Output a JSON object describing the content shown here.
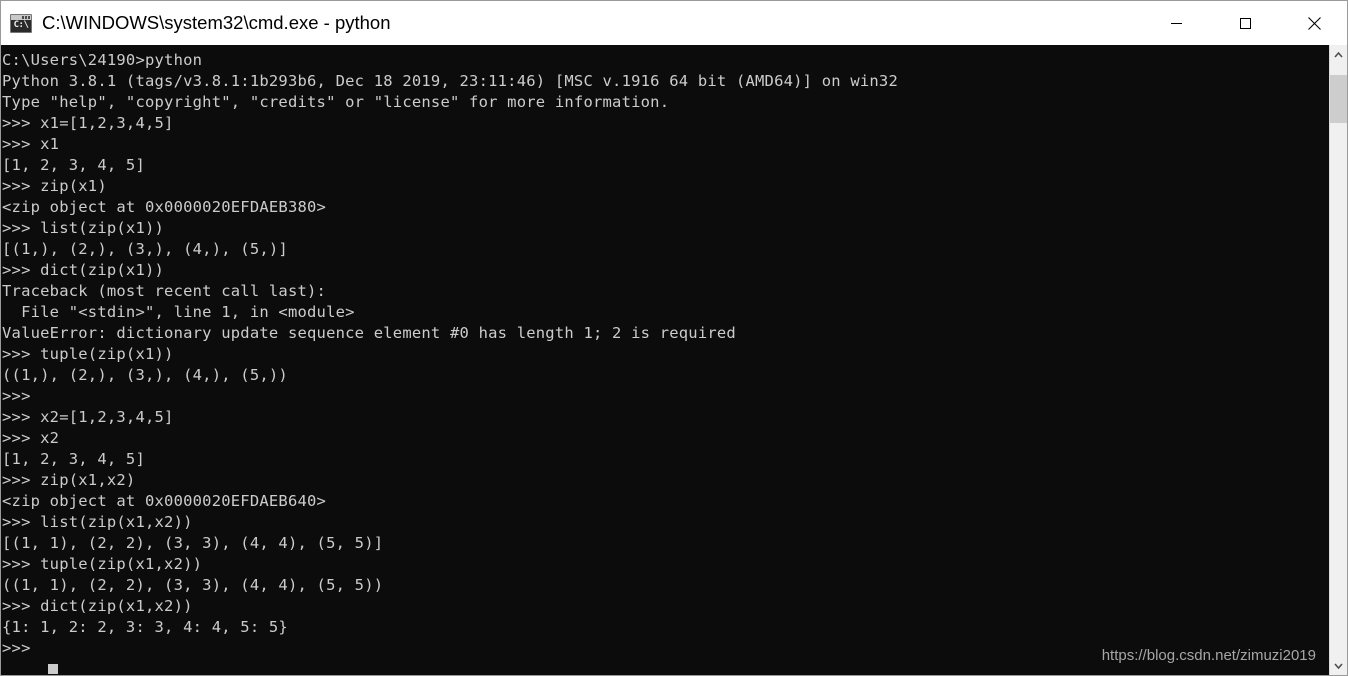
{
  "window": {
    "title": "C:\\WINDOWS\\system32\\cmd.exe - python",
    "icon": "cmd-icon",
    "icon_glyph": "C:\\",
    "background_color": "#0c0c0c",
    "text_color": "#cccccc",
    "titlebar_color": "#ffffff"
  },
  "controls": {
    "minimize_label": "Minimize",
    "maximize_label": "Maximize",
    "close_label": "Close"
  },
  "console": {
    "prompt": ">>>",
    "cursor_visible": true,
    "lines": [
      "C:\\Users\\24190>python",
      "Python 3.8.1 (tags/v3.8.1:1b293b6, Dec 18 2019, 23:11:46) [MSC v.1916 64 bit (AMD64)] on win32",
      "Type \"help\", \"copyright\", \"credits\" or \"license\" for more information.",
      ">>> x1=[1,2,3,4,5]",
      ">>> x1",
      "[1, 2, 3, 4, 5]",
      ">>> zip(x1)",
      "<zip object at 0x0000020EFDAEB380>",
      ">>> list(zip(x1))",
      "[(1,), (2,), (3,), (4,), (5,)]",
      ">>> dict(zip(x1))",
      "Traceback (most recent call last):",
      "  File \"<stdin>\", line 1, in <module>",
      "ValueError: dictionary update sequence element #0 has length 1; 2 is required",
      ">>> tuple(zip(x1))",
      "((1,), (2,), (3,), (4,), (5,))",
      ">>>",
      ">>> x2=[1,2,3,4,5]",
      ">>> x2",
      "[1, 2, 3, 4, 5]",
      ">>> zip(x1,x2)",
      "<zip object at 0x0000020EFDAEB640>",
      ">>> list(zip(x1,x2))",
      "[(1, 1), (2, 2), (3, 3), (4, 4), (5, 5)]",
      ">>> tuple(zip(x1,x2))",
      "((1, 1), (2, 2), (3, 3), (4, 4), (5, 5))",
      ">>> dict(zip(x1,x2))",
      "{1: 1, 2: 2, 3: 3, 4: 4, 5: 5}",
      ">>>"
    ]
  },
  "watermark": {
    "text": "https://blog.csdn.net/zimuzi2019"
  },
  "scrollbar": {
    "up_arrow": "chevron-up-icon",
    "down_arrow": "chevron-down-icon",
    "thumb_color": "#cdcdcd"
  }
}
